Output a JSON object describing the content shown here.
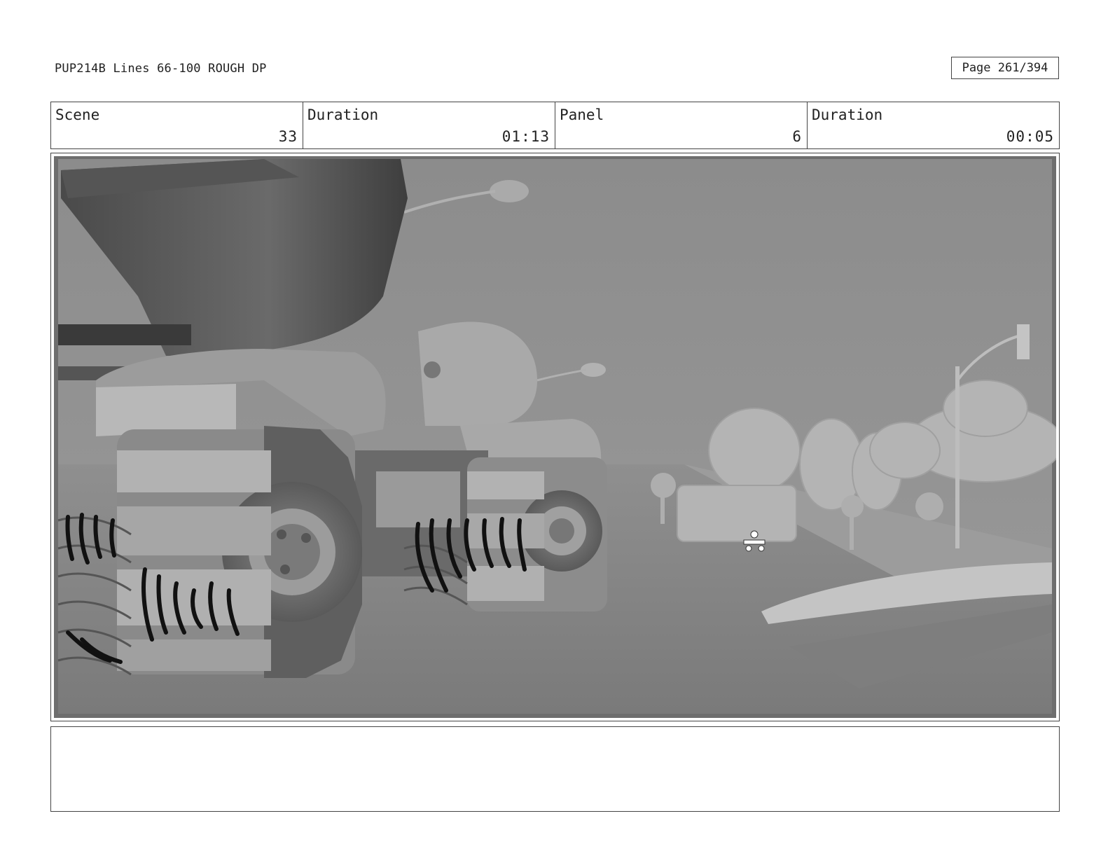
{
  "header": {
    "title": "PUP214B Lines 66-100 ROUGH DP",
    "page": "Page 261/394"
  },
  "info": {
    "scene_label": "Scene",
    "scene_value": "33",
    "scene_duration_label": "Duration",
    "scene_duration_value": "01:13",
    "panel_label": "Panel",
    "panel_value": "6",
    "panel_duration_label": "Duration",
    "panel_duration_value": "00:05"
  },
  "notes": {
    "text": ""
  }
}
